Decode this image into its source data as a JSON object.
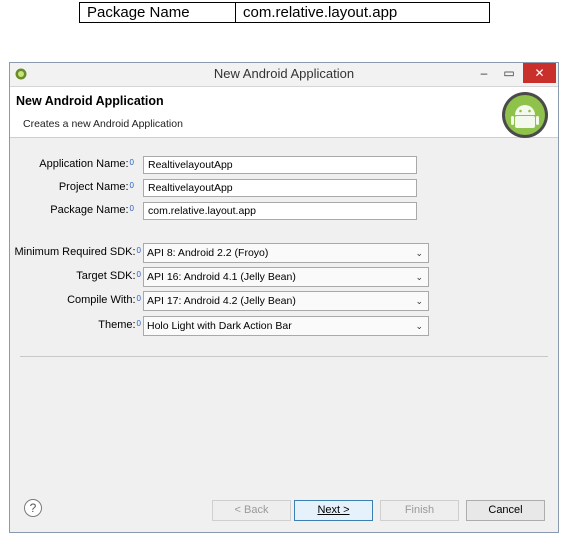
{
  "doc_table": {
    "label": "Package Name",
    "value": "com.relative.layout.app"
  },
  "window": {
    "title": "New Android Application",
    "min_glyph": "–",
    "max_glyph": "▭",
    "close_glyph": "✕"
  },
  "header": {
    "title": "New Android Application",
    "subtitle": "Creates a new Android Application"
  },
  "form": {
    "application_name": {
      "label": "Application Name:",
      "value": "RealtivelayoutApp"
    },
    "project_name": {
      "label": "Project Name:",
      "value": "RealtivelayoutApp"
    },
    "package_name": {
      "label": "Package Name:",
      "value": "com.relative.layout.app"
    },
    "min_sdk": {
      "label": "Minimum Required SDK:",
      "value": "API 8: Android 2.2 (Froyo)"
    },
    "target_sdk": {
      "label": "Target SDK:",
      "value": "API 16: Android 4.1 (Jelly Bean)"
    },
    "compile_with": {
      "label": "Compile With:",
      "value": "API 17: Android 4.2 (Jelly Bean)"
    },
    "theme": {
      "label": "Theme:",
      "value": "Holo Light with Dark Action Bar"
    },
    "info_glyph": "0"
  },
  "buttons": {
    "back": "< Back",
    "next": "Next >",
    "finish": "Finish",
    "cancel": "Cancel",
    "help": "?"
  },
  "colors": {
    "accent": "#3c7fb1",
    "close": "#c9302c",
    "android_green": "#8fc24a"
  },
  "icons": [
    "eclipse-icon",
    "android-logo-icon",
    "help-icon",
    "chevron-down-icon",
    "info-icon"
  ]
}
